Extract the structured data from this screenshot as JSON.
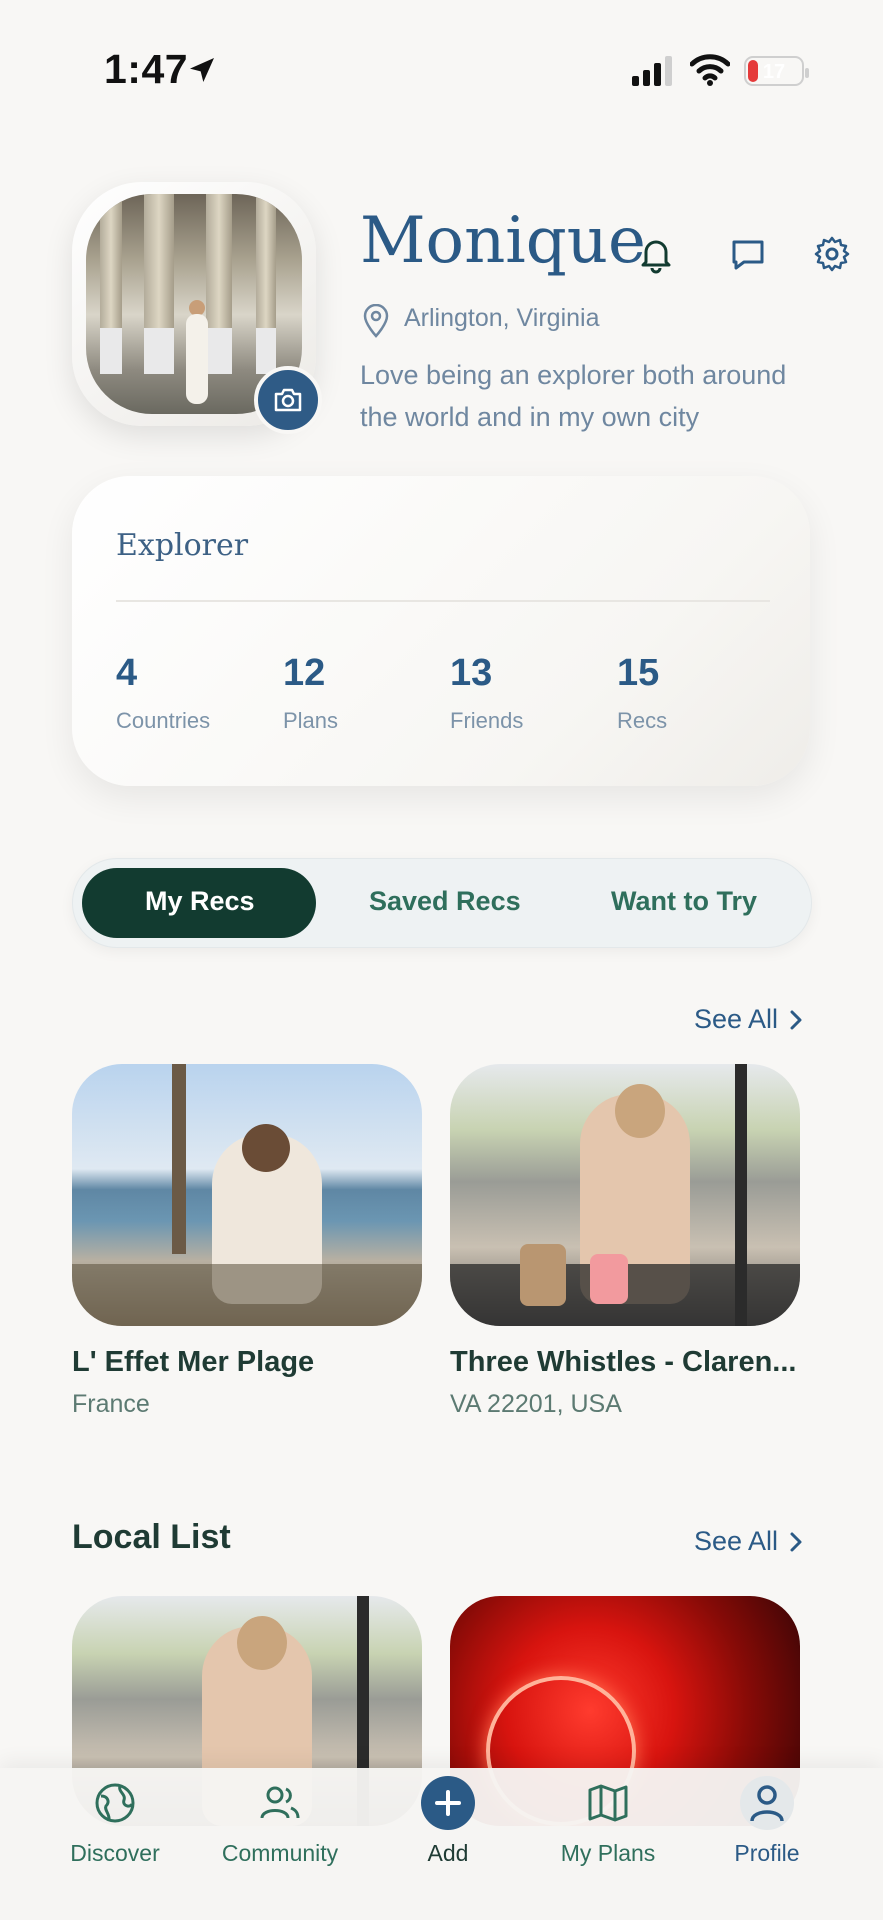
{
  "status_bar": {
    "time": "1:47",
    "battery": "17"
  },
  "profile": {
    "name": "Monique",
    "location": "Arlington, Virginia",
    "bio": "Love being an explorer both around the world and in my own city"
  },
  "explorer_card": {
    "title": "Explorer",
    "stats": [
      {
        "value": "4",
        "label": "Countries"
      },
      {
        "value": "12",
        "label": "Plans"
      },
      {
        "value": "13",
        "label": "Friends"
      },
      {
        "value": "15",
        "label": "Recs"
      }
    ]
  },
  "segmented": {
    "options": [
      "My Recs",
      "Saved Recs",
      "Want to Try"
    ],
    "selected": "My Recs"
  },
  "my_recs": {
    "see_all": "See All",
    "items": [
      {
        "title": "L' Effet Mer Plage",
        "subtitle": "France"
      },
      {
        "title": "Three Whistles - Claren...",
        "subtitle": "VA 22201, USA"
      }
    ]
  },
  "local_list": {
    "title": "Local List",
    "see_all": "See All"
  },
  "tab_bar": {
    "items": [
      {
        "label": "Discover",
        "icon": "globe-icon"
      },
      {
        "label": "Community",
        "icon": "people-icon"
      },
      {
        "label": "Add",
        "icon": "plus-icon"
      },
      {
        "label": "My Plans",
        "icon": "map-icon"
      },
      {
        "label": "Profile",
        "icon": "person-icon"
      }
    ],
    "active": "Profile"
  },
  "colors": {
    "brand_dark_green": "#123b30",
    "accent_blue": "#2b5a86",
    "background": "#f8f7f5",
    "battery_low": "#e53a3a"
  }
}
